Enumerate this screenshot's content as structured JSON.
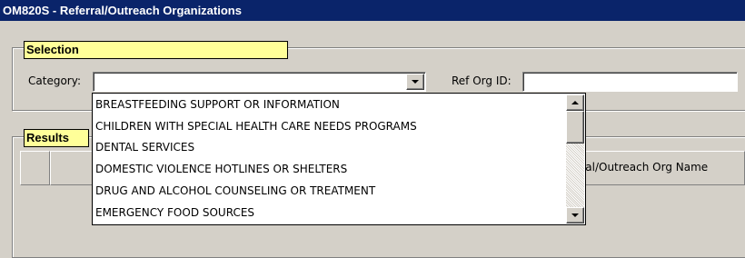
{
  "window": {
    "title": "OM820S - Referral/Outreach Organizations"
  },
  "selection": {
    "heading": "Selection",
    "category_label": "Category:",
    "category_value": "",
    "ref_org_id_label": "Ref Org ID:",
    "ref_org_id_value": ""
  },
  "results": {
    "heading": "Results",
    "columns": [
      "",
      "",
      "ferral/Outreach Org Name"
    ]
  },
  "category_dropdown": {
    "options": [
      "BREASTFEEDING SUPPORT OR INFORMATION",
      "CHILDREN WITH SPECIAL HEALTH CARE NEEDS PROGRAMS",
      "DENTAL SERVICES",
      "DOMESTIC VIOLENCE HOTLINES OR SHELTERS",
      "DRUG AND ALCOHOL COUNSELING OR TREATMENT",
      "EMERGENCY FOOD SOURCES"
    ]
  },
  "colors": {
    "titlebar": "#0a246a",
    "section_label_bg": "#ffff99",
    "window_bg": "#d4d0c8"
  }
}
